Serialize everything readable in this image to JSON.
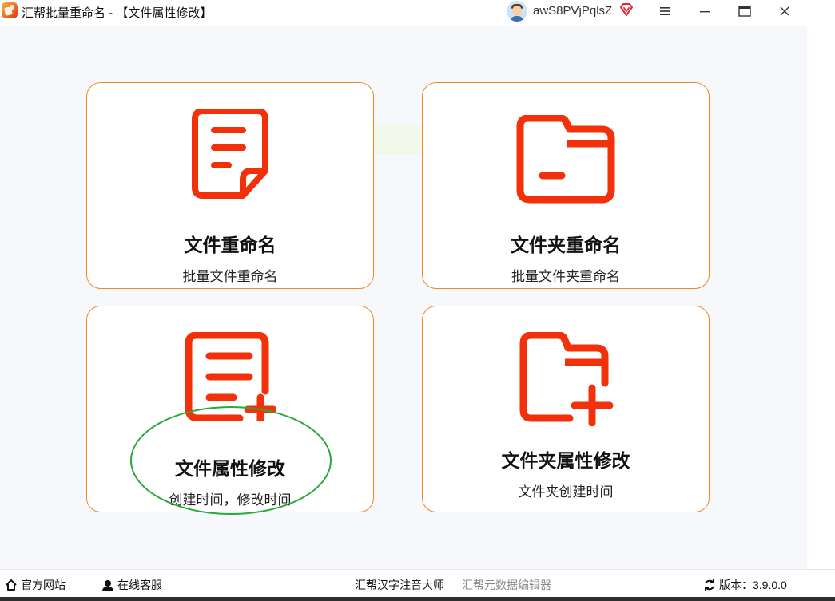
{
  "window": {
    "title": "汇帮批量重命名 - 【文件属性修改】",
    "username": "awS8PVjPqlsZ",
    "accent_color": "#f08a1e",
    "icon_color": "#f2300a"
  },
  "cards": [
    {
      "title": "文件重命名",
      "subtitle": "批量文件重命名",
      "icon": "file-text-icon"
    },
    {
      "title": "文件夹重命名",
      "subtitle": "批量文件夹重命名",
      "icon": "folder-minus-icon"
    },
    {
      "title": "文件属性修改",
      "subtitle": "创建时间，修改时间",
      "icon": "file-plus-icon",
      "highlighted": true
    },
    {
      "title": "文件夹属性修改",
      "subtitle": "文件夹创建时间",
      "icon": "folder-plus-icon"
    }
  ],
  "status": {
    "website": "官方网站",
    "support": "在线客服",
    "link1": "汇帮汉字注音大师",
    "link2": "汇帮元数据编辑器",
    "version": "版本：3.9.0.0"
  }
}
